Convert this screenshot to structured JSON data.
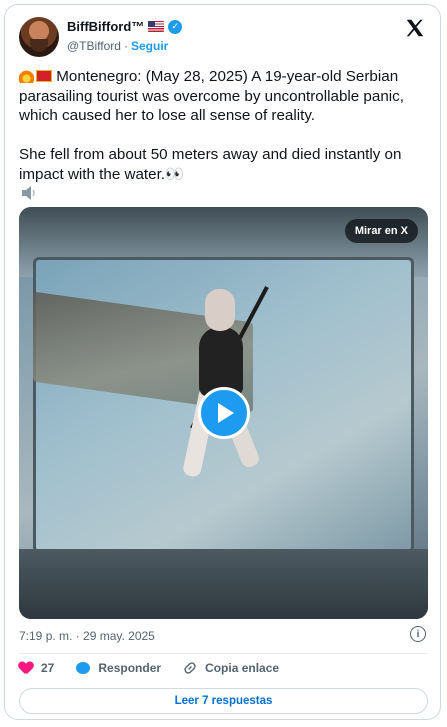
{
  "author": {
    "name": "BiffBifford™",
    "handle": "@TBifford",
    "separator": "·",
    "follow_label": "Seguir"
  },
  "tweet": {
    "line1_text": " Montenegro: (May 28, 2025) A 19-year-old Serbian parasailing tourist was overcome by uncontrollable panic, which caused her to lose all sense of reality.",
    "line2_text": "She fell from about 50 meters away and died instantly on impact with the water.👀",
    "emojis": [
      "fire-icon",
      "montenegro-flag-icon",
      "eyes-icon",
      "speaker-icon"
    ]
  },
  "media": {
    "watch_label": "Mirar en X",
    "play_icon": "play-icon"
  },
  "meta": {
    "timestamp": "7:19 p. m. · 29 may. 2025"
  },
  "actions": {
    "likes_count": "27",
    "reply_label": "Responder",
    "copy_link_label": "Copia enlace"
  },
  "replies_button": {
    "label": "Leer 7 respuestas"
  },
  "colors": {
    "accent": "#1d9bf0",
    "like": "#f91880",
    "text": "#0f1419",
    "muted": "#536471",
    "border": "#cfd9de"
  }
}
